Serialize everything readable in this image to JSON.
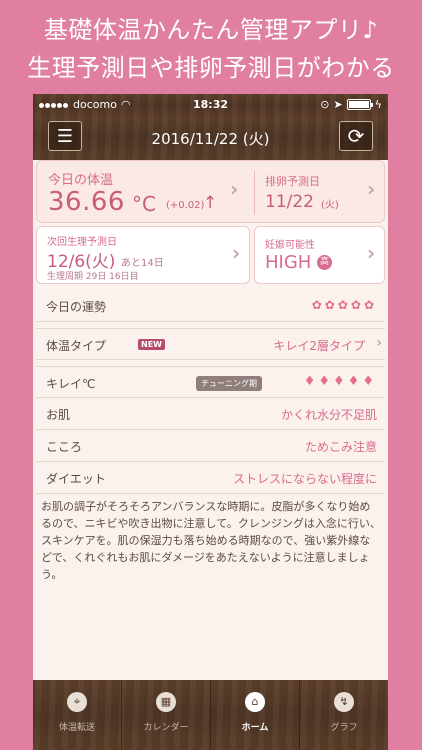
{
  "headline": {
    "line1": "基礎体温かんたん管理アプリ♪",
    "line2": "生理予測日や排卵予測日がわかる"
  },
  "status_bar": {
    "carrier": "docomo",
    "time": "18:32"
  },
  "nav": {
    "title": "2016/11/22 (火)",
    "menu_icon": "list-icon",
    "refresh_icon": "refresh-icon"
  },
  "today_temp": {
    "title": "今日の体温",
    "value": "36.66",
    "unit": "°C",
    "diff": "(+0.02)",
    "trend": "↑"
  },
  "ovulation": {
    "title": "排卵予測日",
    "date": "11/22",
    "dow": "(火)"
  },
  "next_period": {
    "title": "次回生理予測日",
    "date": "12/6(火)",
    "remaining": "あと14日",
    "cycle": "生理周期  29日  16日目"
  },
  "fertility": {
    "title": "妊娠可能性",
    "value": "HIGH",
    "badge": "高"
  },
  "rows": {
    "fortune": {
      "label": "今日の運勢",
      "rating": "✿✿✿✿✿"
    },
    "temp_type": {
      "label": "体温タイプ",
      "badge": "NEW",
      "value": "キレイ2層タイプ"
    },
    "kirei": {
      "label": "キレイ℃",
      "badge": "チューニング期",
      "rating": "♦♦♦♦♦"
    },
    "skin": {
      "label": "お肌",
      "value": "かくれ水分不足肌"
    },
    "mind": {
      "label": "こころ",
      "value": "ためこみ注意"
    },
    "diet": {
      "label": "ダイエット",
      "value": "ストレスにならない程度に"
    }
  },
  "description": "お肌の調子がそろそろアンバランスな時期に。皮脂が多くなり始めるので、ニキビや吹き出物に注意して。クレンジングは入念に行い、スキンケアを。肌の保湿力も落ち始める時期なので、強い紫外線などで、くれぐれもお肌にダメージをあたえないように注意しましょう。",
  "tabs": [
    {
      "label": "体温転送",
      "icon": "pin-icon",
      "glyph": "⌖"
    },
    {
      "label": "カレンダー",
      "icon": "calendar-icon",
      "glyph": "▦"
    },
    {
      "label": "ホーム",
      "icon": "home-icon",
      "glyph": "⌂"
    },
    {
      "label": "グラフ",
      "icon": "graph-icon",
      "glyph": "↯"
    }
  ],
  "colors": {
    "background": "#e07f9f",
    "accent": "#d86c8c",
    "wood": "#5c3f2b"
  }
}
